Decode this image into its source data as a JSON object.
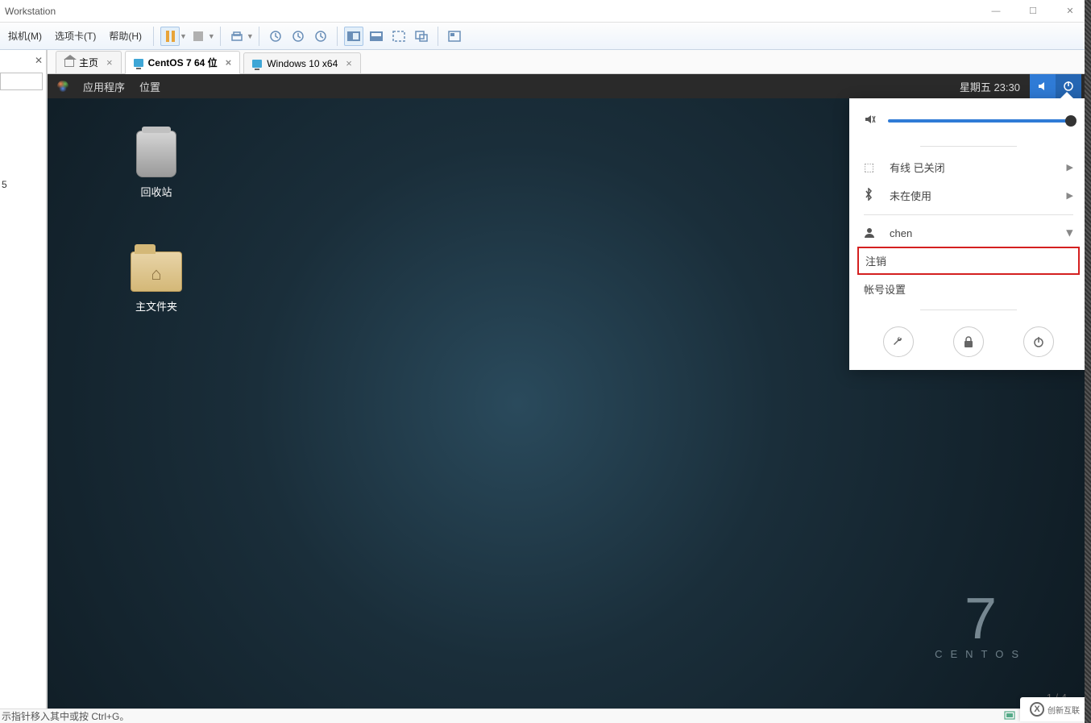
{
  "window": {
    "title": "Workstation"
  },
  "menu": {
    "vm": "拟机(M)",
    "tabs": "选项卡(T)",
    "help": "帮助(H)"
  },
  "vm_tabs": {
    "home": "主页",
    "centos": "CentOS 7 64 位",
    "windows": "Windows 10 x64"
  },
  "gnome": {
    "apps": "应用程序",
    "places": "位置",
    "datetime": "星期五 23:30"
  },
  "desktop_icons": {
    "trash": "回收站",
    "home": "主文件夹"
  },
  "centos_brand": {
    "num": "7",
    "name": "CENTOS"
  },
  "sysmenu": {
    "wired": "有线 已关闭",
    "bt": "未在使用",
    "user": "chen",
    "logout": "注销",
    "account": "帐号设置"
  },
  "page_indicator": "1 / 4",
  "statusbar": {
    "hint": "示指针移入其中或按 Ctrl+G。"
  },
  "watermark": "创新互联",
  "left_pane_fragment": "5"
}
